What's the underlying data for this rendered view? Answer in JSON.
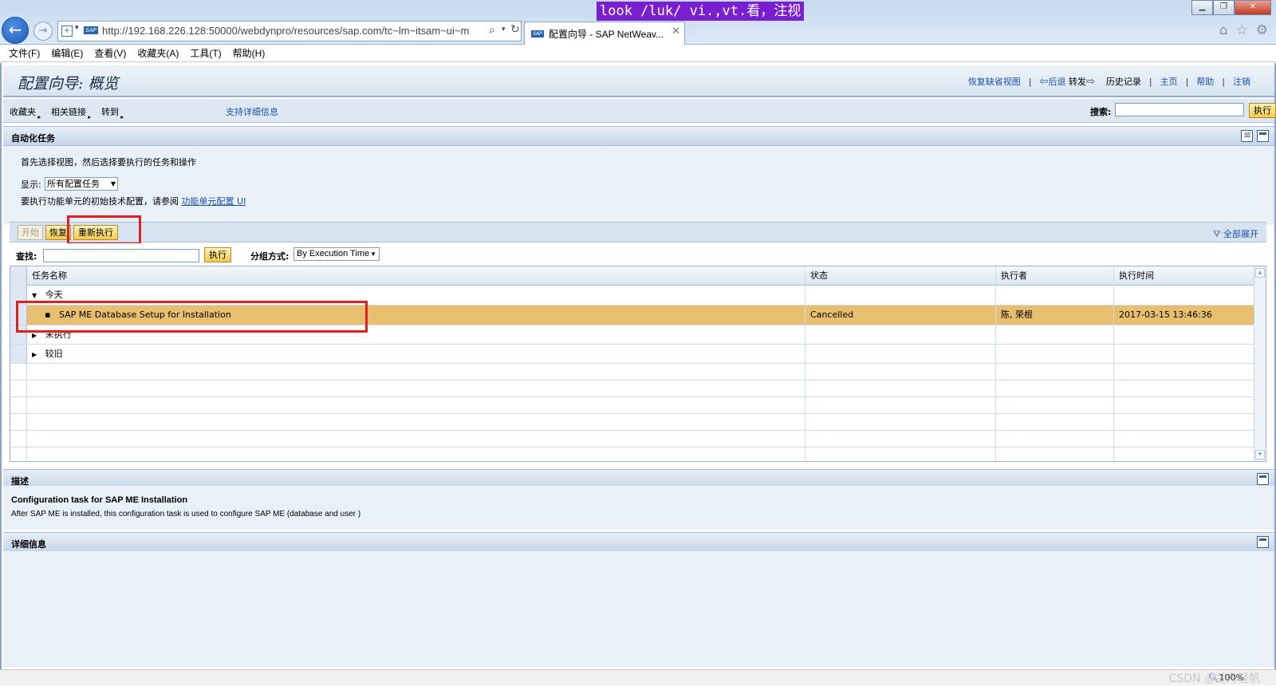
{
  "browser": {
    "url": "http://192.168.226.128:50000/webdynpro/resources/sap.com/tc~lm~itsam~ui~m",
    "tab_title": "配置向导 - SAP NetWeav...",
    "tooltip": "look /luk/  vi.,vt.看，注视",
    "zoom": "100%"
  },
  "menubar": [
    "文件(F)",
    "编辑(E)",
    "查看(V)",
    "收藏夹(A)",
    "工具(T)",
    "帮助(H)"
  ],
  "header": {
    "title": "配置向导: 概览",
    "links": {
      "restore_default": "恢复缺省视图",
      "back": "后退",
      "forward": "转发",
      "history": "历史记录",
      "home": "主页",
      "help": "帮助",
      "logoff": "注销"
    }
  },
  "navbar": {
    "favorites": "收藏夹",
    "related_links": "相关链接",
    "goto": "转到",
    "support_info": "支持详细信息",
    "search_label": "搜索:",
    "execute": "执行"
  },
  "automation": {
    "title": "自动化任务",
    "intro": "首先选择视图，然后选择要执行的任务和操作",
    "show_label": "显示:",
    "show_value": "所有配置任务",
    "note_prefix": "要执行功能单元的初始技术配置，请参阅",
    "note_link": "功能单元配置 UI",
    "buttons": {
      "start": "开始",
      "resume": "恢复",
      "rerun": "重新执行"
    },
    "expand_all": "全部展开",
    "find_label": "查找:",
    "find_execute": "执行",
    "group_label": "分组方式:",
    "group_value": "By Execution Time"
  },
  "table": {
    "columns": [
      "任务名称",
      "状态",
      "执行者",
      "执行时间"
    ],
    "rows": [
      {
        "name": "今天",
        "status": "",
        "executor": "",
        "time": "",
        "kind": "group-open"
      },
      {
        "name": "SAP ME Database Setup for Installation",
        "status": "Cancelled",
        "executor": "陈, 荣根",
        "time": "2017-03-15 13:46:36",
        "kind": "item"
      },
      {
        "name": "未执行",
        "status": "",
        "executor": "",
        "time": "",
        "kind": "group-closed"
      },
      {
        "name": "较旧",
        "status": "",
        "executor": "",
        "time": "",
        "kind": "group-closed"
      }
    ]
  },
  "description": {
    "title": "描述",
    "heading": "Configuration task for SAP ME Installation",
    "text": "After SAP ME is installed, this configuration task  is used to configure SAP ME (database and user )"
  },
  "details": {
    "title": "详细信息"
  },
  "watermark": "CSDN @兰舟轻帆"
}
